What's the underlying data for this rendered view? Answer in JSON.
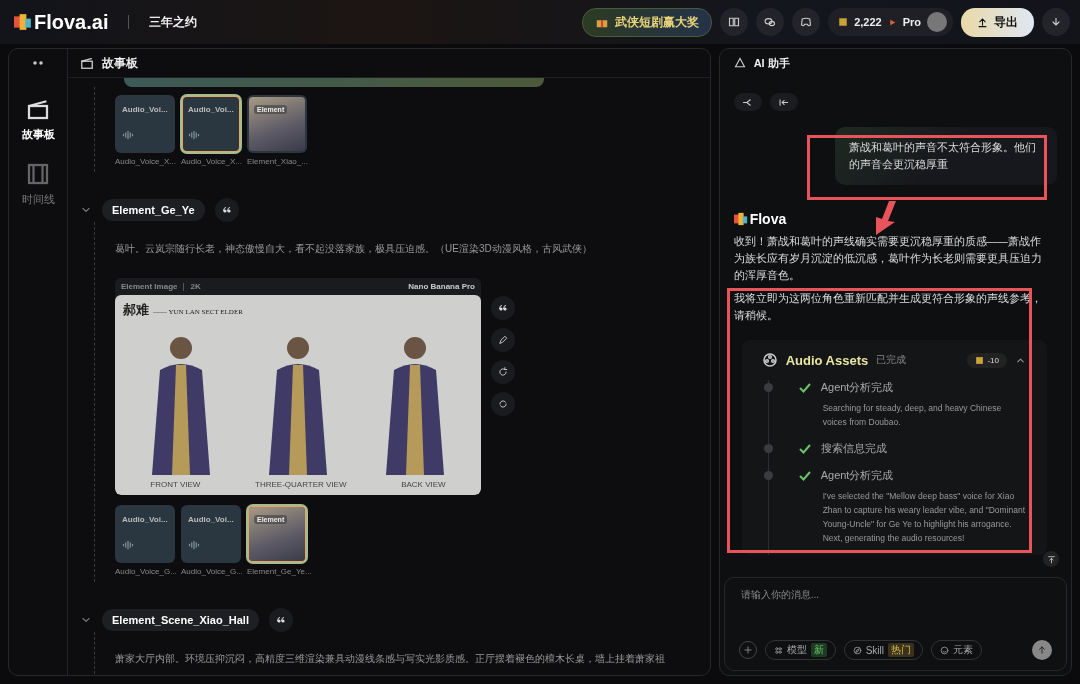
{
  "header": {
    "logo": "Flova.ai",
    "project": "三年之约",
    "promo": "武侠短剧赢大奖",
    "credits": "2,222",
    "plan": "Pro",
    "export": "导出"
  },
  "rail": {
    "items": [
      {
        "label": "故事板",
        "kind": "storyboard",
        "selected": true
      },
      {
        "label": "时间线",
        "kind": "timeline",
        "selected": false
      }
    ]
  },
  "storyboard": {
    "title": "故事板",
    "top_thumbnails": [
      {
        "kind": "audio",
        "title": "Audio_Voi...",
        "caption": "Audio_Voice_X...",
        "selected": false
      },
      {
        "kind": "audio",
        "title": "Audio_Voi...",
        "caption": "Audio_Voice_X...",
        "selected": true
      },
      {
        "kind": "element",
        "badge": "Element",
        "caption": "Element_Xiao_...",
        "selected": false
      }
    ],
    "sections": [
      {
        "name": "Element_Ge_Ye",
        "expanded": true,
        "description": "葛叶。云岚宗随行长老，神态傲慢自大，看不起没落家族，极具压迫感。（UE渲染3D动漫风格，古风武侠）",
        "image": {
          "label": "Element Image",
          "resolution": "2K",
          "model": "Nano Banana Pro",
          "heading": "郝难",
          "subtitle": "—— YUN LAN SECT ELDER",
          "views": [
            "FRONT VIEW",
            "THREE-QUARTER VIEW",
            "BACK VIEW"
          ]
        },
        "thumbnails": [
          {
            "kind": "audio",
            "title": "Audio_Voi...",
            "caption": "Audio_Voice_G...",
            "selected": false
          },
          {
            "kind": "audio",
            "title": "Audio_Voi...",
            "caption": "Audio_Voice_G...",
            "selected": false
          },
          {
            "kind": "element",
            "badge": "Element",
            "caption": "Element_Ge_Ye...",
            "selected": true
          }
        ]
      },
      {
        "name": "Element_Scene_Xiao_Hall",
        "expanded": true,
        "description": "萧家大厅内部。环境压抑沉闷，高精度三维渲染兼具动漫线条感与写实光影质感。正厅摆着褪色的檀木长桌，墙上挂着萧家祖"
      }
    ]
  },
  "assistant": {
    "title": "AI 助手",
    "user_message": "萧战和葛叶的声音不太符合形象。他们的声音会更沉稳厚重",
    "bot_name": "Flova",
    "replies": [
      "收到！萧战和葛叶的声线确实需要更沉稳厚重的质感——萧战作为族长应有岁月沉淀的低沉感，葛叶作为长老则需要更具压迫力的浑厚音色。",
      "我将立即为这两位角色重新匹配并生成更符合形象的声线参考，请稍候。"
    ],
    "task": {
      "title": "Audio Assets",
      "status": "已完成",
      "cost": "-10",
      "expanded": true,
      "steps": [
        {
          "title": "Agent分析完成",
          "done": true,
          "detail": "Searching for steady, deep, and heavy Chinese voices from Doubao."
        },
        {
          "title": "搜索信息完成",
          "done": true
        },
        {
          "title": "Agent分析完成",
          "done": true,
          "detail": "I've selected the \"Mellow deep bass\" voice for Xiao Zhan to capture his weary leader vibe, and \"Dominant Young-Uncle\" for Ge Ye to highlight his arrogance. Next, generating the audio resources!"
        }
      ]
    },
    "input": {
      "placeholder": "请输入你的消息...",
      "tools": [
        {
          "kind": "model",
          "label": "模型",
          "badge": "新"
        },
        {
          "kind": "skill",
          "label": "Skill",
          "badge": "热门"
        },
        {
          "kind": "element",
          "label": "元素"
        }
      ]
    }
  }
}
